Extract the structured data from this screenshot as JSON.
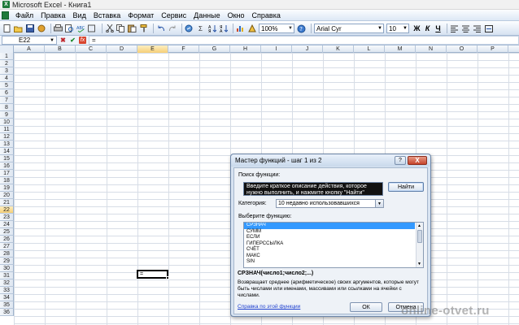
{
  "window": {
    "title": "Microsoft Excel - Книга1",
    "app_icon": "X"
  },
  "menu": [
    "Файл",
    "Правка",
    "Вид",
    "Вставка",
    "Формат",
    "Сервис",
    "Данные",
    "Окно",
    "Справка"
  ],
  "toolbar": {
    "zoom": "100%",
    "font_name": "Arial Cyr",
    "font_size": "10",
    "bold": "Ж",
    "italic": "К",
    "underline": "Ч",
    "sum_symbol": "Σ",
    "help_symbol": "?"
  },
  "formula_bar": {
    "cell_ref": "E22",
    "fx": "fx",
    "content": "="
  },
  "columns": [
    "A",
    "B",
    "C",
    "D",
    "E",
    "F",
    "G",
    "H",
    "I",
    "J",
    "K",
    "L",
    "M",
    "N",
    "O",
    "P"
  ],
  "rows": [
    "1",
    "2",
    "3",
    "4",
    "5",
    "6",
    "7",
    "8",
    "9",
    "10",
    "11",
    "12",
    "13",
    "14",
    "15",
    "16",
    "17",
    "18",
    "19",
    "20",
    "21",
    "22",
    "23",
    "24",
    "25",
    "26",
    "27",
    "28",
    "29",
    "30",
    "31",
    "32",
    "33",
    "34",
    "35",
    "36"
  ],
  "active_cell": {
    "ref": "E22",
    "value": "="
  },
  "dialog": {
    "title": "Мастер функций - шаг 1 из 2",
    "help_button": "?",
    "close_button": "X",
    "search_label": "Поиск функции:",
    "search_value": "Введите краткое описание действия, которое нужно выполнить, и нажмите кнопку \"Найти\"",
    "find_button": "Найти",
    "category_label": "Категория:",
    "category_value": "10 недавно использовавшихся",
    "choose_label": "Выберите функцию:",
    "functions": [
      "СРЗНАЧ",
      "СУММ",
      "ЕСЛИ",
      "ГИПЕРССЫЛКА",
      "СЧЁТ",
      "МАКС",
      "SIN"
    ],
    "selected_function": "СРЗНАЧ",
    "signature": "СРЗНАЧ(число1;число2;...)",
    "description": "Возвращает среднее (арифметическое) своих аргументов, которые могут быть числами или именами, массивами или ссылками на ячейки с числами.",
    "help_link": "Справка по этой функции",
    "ok_button": "ОК",
    "cancel_button": "Отмена"
  },
  "watermark": "online-otvet.ru"
}
